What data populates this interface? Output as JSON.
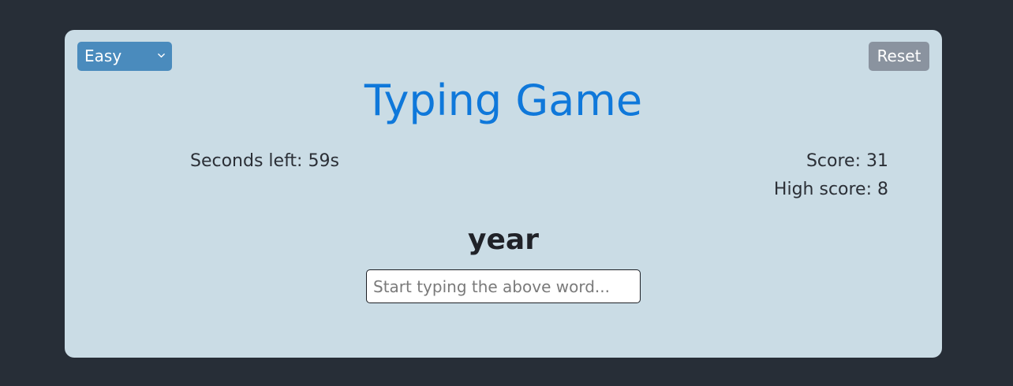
{
  "difficulty": {
    "selected": "Easy",
    "icon": "chevron-down-icon"
  },
  "reset_label": "Reset",
  "title": "Typing Game",
  "timer_text": "Seconds left: 59s",
  "score_text": "Score: 31",
  "high_score_text": "High score: 8",
  "current_word": "year",
  "input": {
    "value": "",
    "placeholder": "Start typing the above word..."
  },
  "colors": {
    "page_bg": "#272e37",
    "card_bg": "#cadce5",
    "title": "#0f78da",
    "select_bg": "#4a8bbd",
    "reset_bg": "#8a939f"
  }
}
